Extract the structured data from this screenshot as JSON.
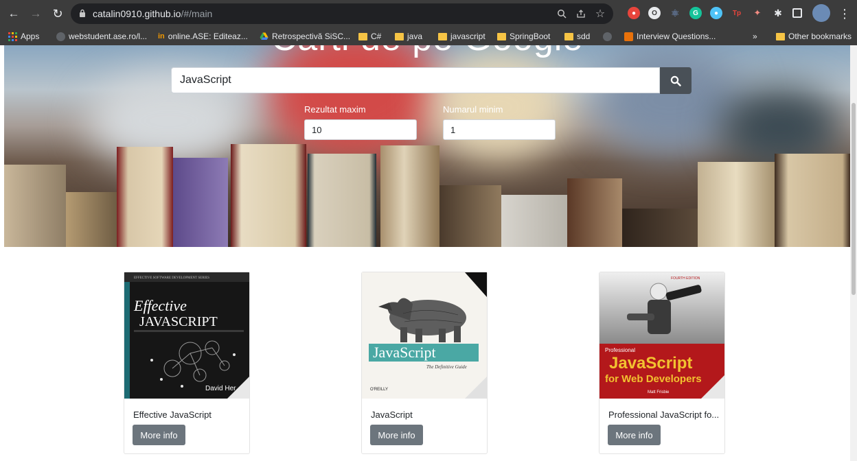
{
  "browser": {
    "url_host": "catalin0910.github.io",
    "url_path": "/#/main",
    "bookmarks": [
      {
        "label": "Apps",
        "icon": "apps-grid-icon"
      },
      {
        "label": "webstudent.ase.ro/l...",
        "icon": "globe-icon"
      },
      {
        "label": "online.ASE: Editeaz...",
        "icon": "online-ase-icon"
      },
      {
        "label": "Retrospectivă SiSC...",
        "icon": "google-drive-icon"
      },
      {
        "label": "C#",
        "icon": "folder-icon"
      },
      {
        "label": "java",
        "icon": "folder-icon"
      },
      {
        "label": "javascript",
        "icon": "folder-icon"
      },
      {
        "label": "SpringBoot",
        "icon": "folder-icon"
      },
      {
        "label": "sdd",
        "icon": "folder-icon"
      },
      {
        "label": "Interview Questions...",
        "icon": "bookmark-icon"
      }
    ],
    "overflow_label": "»",
    "other_bookmarks": "Other bookmarks"
  },
  "hero": {
    "title": "Carti de pe Google",
    "search_value": "JavaScript",
    "max_label": "Rezultat maxim",
    "max_value": "10",
    "min_label": "Numarul minim",
    "min_value": "1"
  },
  "books": [
    {
      "title": "Effective JavaScript",
      "button": "More info",
      "cover": {
        "line1": "Effective",
        "line2": "JAVASCRIPT",
        "author": "David Her",
        "series": "EFFECTIVE SOFTWARE DEVELOPMENT SERIES"
      }
    },
    {
      "title": "JavaScript",
      "button": "More info",
      "cover": {
        "line1": "JavaScript",
        "line2": "The Definitive Guide",
        "publisher": "O'REILLY"
      }
    },
    {
      "title": "Professional JavaScript fo...",
      "button": "More info",
      "cover": {
        "line0": "Professional",
        "line1": "JavaScript",
        "line2": "for Web Developers",
        "edition": "FOURTH EDITION",
        "author": "Matt Frisbie"
      }
    }
  ],
  "colors": {
    "chrome_bg": "#3c3c3c",
    "omnibox_bg": "#202124",
    "search_button": "#495057",
    "more_button": "#6c757d",
    "pro_cover_red": "#b3181b",
    "pro_cover_yellow": "#f2c230",
    "rhino_teal": "#4aa8a4"
  }
}
